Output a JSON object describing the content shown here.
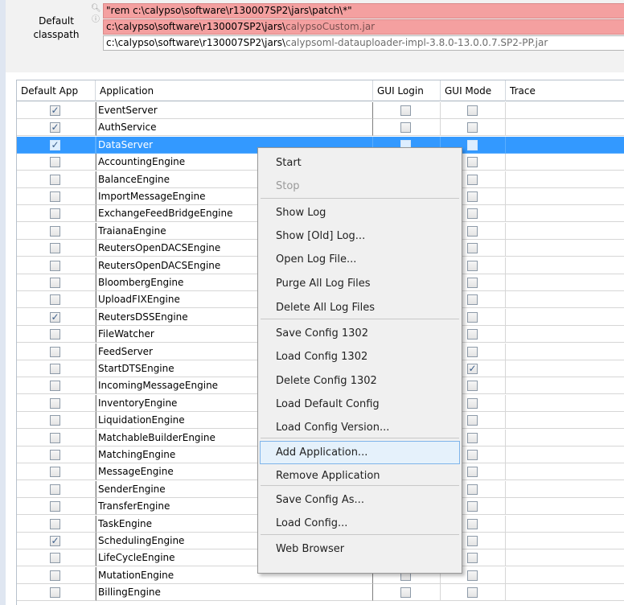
{
  "classpath": {
    "label": "Default\nclasspath",
    "entries": [
      {
        "prefix": "\"rem c:\\calypso\\software\\r130007SP2\\jars\\patch\\*\"",
        "suffix": "",
        "status": "error"
      },
      {
        "prefix": "c:\\calypso\\software\\r130007SP2\\jars\\",
        "suffix": "calypsoCustom.jar",
        "status": "error"
      },
      {
        "prefix": "c:\\calypso\\software\\r130007SP2\\jars\\",
        "suffix": "calypsoml-datauploader-impl-3.8.0-13.0.0.7.SP2-PP.jar",
        "status": "ok"
      }
    ]
  },
  "table": {
    "columns": [
      "Default App",
      "Application",
      "GUI Login",
      "GUI Mode",
      "Trace"
    ],
    "rows": [
      {
        "default": true,
        "name": "EventServer",
        "gui_login": false,
        "gui_mode": false
      },
      {
        "default": true,
        "name": "AuthService",
        "gui_login": false,
        "gui_mode": false
      },
      {
        "default": true,
        "name": "DataServer",
        "gui_login": false,
        "gui_mode": false,
        "selected": true
      },
      {
        "default": false,
        "name": "AccountingEngine",
        "gui_login": false,
        "gui_mode": false
      },
      {
        "default": false,
        "name": "BalanceEngine",
        "gui_login": false,
        "gui_mode": false
      },
      {
        "default": false,
        "name": "ImportMessageEngine",
        "gui_login": false,
        "gui_mode": false
      },
      {
        "default": false,
        "name": "ExchangeFeedBridgeEngine",
        "gui_login": false,
        "gui_mode": false
      },
      {
        "default": false,
        "name": "TraianaEngine",
        "gui_login": false,
        "gui_mode": false
      },
      {
        "default": false,
        "name": "ReutersOpenDACSEngine",
        "gui_login": false,
        "gui_mode": false
      },
      {
        "default": false,
        "name": "ReutersOpenDACSEngine",
        "gui_login": false,
        "gui_mode": false
      },
      {
        "default": false,
        "name": "BloombergEngine",
        "gui_login": false,
        "gui_mode": false
      },
      {
        "default": false,
        "name": "UploadFIXEngine",
        "gui_login": false,
        "gui_mode": false
      },
      {
        "default": true,
        "name": "ReutersDSSEngine",
        "gui_login": false,
        "gui_mode": false
      },
      {
        "default": false,
        "name": "FileWatcher",
        "gui_login": false,
        "gui_mode": false
      },
      {
        "default": false,
        "name": "FeedServer",
        "gui_login": false,
        "gui_mode": false
      },
      {
        "default": false,
        "name": "StartDTSEngine",
        "gui_login": false,
        "gui_mode": true
      },
      {
        "default": false,
        "name": "IncomingMessageEngine",
        "gui_login": false,
        "gui_mode": false
      },
      {
        "default": false,
        "name": "InventoryEngine",
        "gui_login": false,
        "gui_mode": false
      },
      {
        "default": false,
        "name": "LiquidationEngine",
        "gui_login": false,
        "gui_mode": false
      },
      {
        "default": false,
        "name": "MatchableBuilderEngine",
        "gui_login": false,
        "gui_mode": false
      },
      {
        "default": false,
        "name": "MatchingEngine",
        "gui_login": false,
        "gui_mode": false
      },
      {
        "default": false,
        "name": "MessageEngine",
        "gui_login": false,
        "gui_mode": false
      },
      {
        "default": false,
        "name": "SenderEngine",
        "gui_login": false,
        "gui_mode": false
      },
      {
        "default": false,
        "name": "TransferEngine",
        "gui_login": false,
        "gui_mode": false
      },
      {
        "default": false,
        "name": "TaskEngine",
        "gui_login": false,
        "gui_mode": false
      },
      {
        "default": true,
        "name": "SchedulingEngine",
        "gui_login": false,
        "gui_mode": false
      },
      {
        "default": false,
        "name": "LifeCycleEngine",
        "gui_login": false,
        "gui_mode": false
      },
      {
        "default": false,
        "name": "MutationEngine",
        "gui_login": false,
        "gui_mode": false
      },
      {
        "default": false,
        "name": "BillingEngine",
        "gui_login": false,
        "gui_mode": false
      }
    ]
  },
  "context_menu": {
    "items": [
      {
        "label": "Start"
      },
      {
        "label": "Stop",
        "disabled": true
      },
      {
        "label": "Show Log",
        "sep_before": true
      },
      {
        "label": "Show [Old] Log..."
      },
      {
        "label": "Open Log File..."
      },
      {
        "label": "Purge All Log Files"
      },
      {
        "label": "Delete All Log Files"
      },
      {
        "label": "Save Config 1302",
        "sep_before": true
      },
      {
        "label": "Load Config 1302"
      },
      {
        "label": "Delete Config 1302"
      },
      {
        "label": "Load Default Config"
      },
      {
        "label": "Load Config Version..."
      },
      {
        "label": "Add Application...",
        "sep_before": true,
        "highlighted": true
      },
      {
        "label": "Remove Application"
      },
      {
        "label": "Save Config As...",
        "sep_before": true
      },
      {
        "label": "Load Config..."
      },
      {
        "label": "Web Browser",
        "sep_before": true
      }
    ]
  },
  "icons": {
    "search": "search-icon",
    "info": "info-icon",
    "check": "checkmark-icon"
  },
  "colors": {
    "selection": "#3399ff",
    "error_field": "#f4a0a0",
    "menu_highlight": "#e5f1fb"
  }
}
